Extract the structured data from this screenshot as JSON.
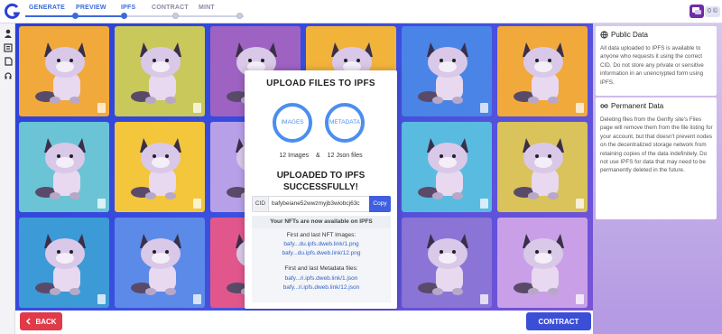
{
  "header": {
    "steps": [
      {
        "label": "GENERATE",
        "state": "done"
      },
      {
        "label": "PREVIEW",
        "state": "done"
      },
      {
        "label": "IPFS",
        "state": "active"
      },
      {
        "label": "CONTRACT",
        "state": "todo"
      },
      {
        "label": "MINT",
        "state": "todo"
      }
    ],
    "credits": "0 ©"
  },
  "grid": {
    "tiles": [
      {
        "bg": "#f2a93b"
      },
      {
        "bg": "#c9c85a"
      },
      {
        "bg": "#9e62c2"
      },
      {
        "bg": "#f2b33b"
      },
      {
        "bg": "#4a84e6"
      },
      {
        "bg": "#f2a93b"
      },
      {
        "bg": "#6ac4d6"
      },
      {
        "bg": "#f3c63b"
      },
      {
        "bg": "#b8a0e8"
      },
      {
        "bg": "#5fbcd0"
      },
      {
        "bg": "#5abbe0"
      },
      {
        "bg": "#d9c35a"
      },
      {
        "bg": "#3c9ad6"
      },
      {
        "bg": "#5c8ae8"
      },
      {
        "bg": "#e1578c"
      },
      {
        "bg": "#4aa8e0"
      },
      {
        "bg": "#8a74d6"
      },
      {
        "bg": "#c9a0e8"
      }
    ]
  },
  "modal": {
    "title": "UPLOAD FILES TO IPFS",
    "ring_images": "IMAGES",
    "ring_metadata": "METADATA",
    "images_count": "12 Images",
    "amp": "&",
    "json_count": "12 Json files",
    "success_line1": "UPLOADED TO IPFS",
    "success_line2": "SUCCESSFULLY!",
    "cid_label": "CID",
    "cid_value": "bafybeiane52wwzmyjb3wiobcj63c",
    "copy_label": "Copy",
    "notice": "Your NFTs are now available on IPFS",
    "images_heading": "First and last NFT Images:",
    "image_first": "bafy...du.ipfs.dweb.link/1.png",
    "image_last": "bafy...du.ipfs.dweb.link/12.png",
    "metadata_heading": "First and last Metadata files:",
    "meta_first": "bafy...ri.ipfs.dweb.link/1.json",
    "meta_last": "bafy...ri.ipfs.dweb.link/12.json"
  },
  "info": {
    "public_title": "Public Data",
    "public_body": "All data uploaded to IPFS is available to anyone who requests it using the correct CID. Do not store any private or sensitive information in an unencrypted form using IPFS.",
    "permanent_title": "Permanent Data",
    "permanent_body": "Deleting files from the Genfty site's Files page will remove them from the file listing for your account, but that doesn't prevent nodes on the decentralized storage network from retaining copies of the data indefinitely. Do not use IPFS for data that may need to be permanently deleted in the future."
  },
  "footer": {
    "back_label": "BACK",
    "contract_label": "CONTRACT"
  },
  "colors": {
    "accent": "#3c6ad8",
    "back": "#e13a48",
    "primary": "#3a4fd6"
  }
}
